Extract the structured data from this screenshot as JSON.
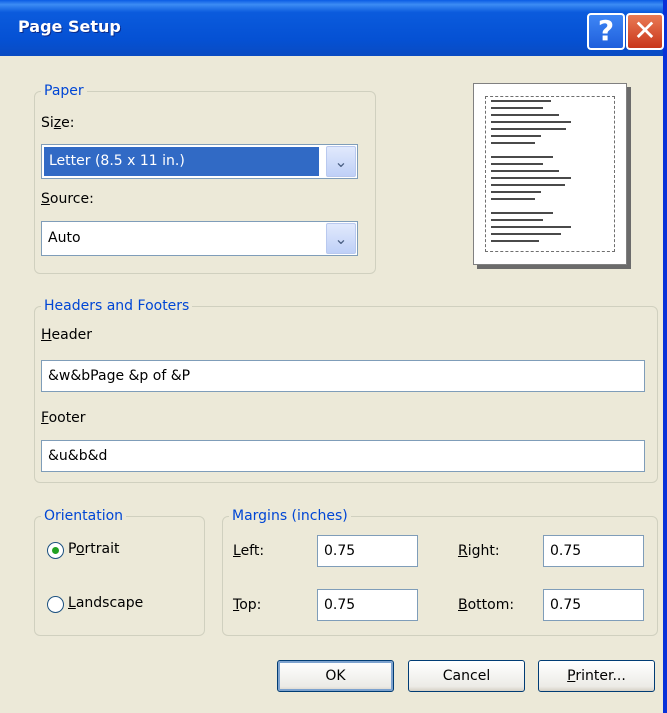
{
  "window": {
    "title": "Page Setup",
    "help_glyph": "?",
    "close_glyph": "✕"
  },
  "paper": {
    "legend": "Paper",
    "size_label_pre": "Si",
    "size_label_ul": "z",
    "size_label_post": "e:",
    "size_value": "Letter (8.5 x 11 in.)",
    "source_label_ul": "S",
    "source_label_post": "ource:",
    "source_value": "Auto"
  },
  "headers_footers": {
    "legend": "Headers and Footers",
    "header_label_ul": "H",
    "header_label_post": "eader",
    "header_value": "&w&bPage &p of &P",
    "footer_label_ul": "F",
    "footer_label_post": "ooter",
    "footer_value": "&u&b&d"
  },
  "orientation": {
    "legend": "Orientation",
    "portrait_label_pre": "P",
    "portrait_label_ul": "o",
    "portrait_label_post": "rtrait",
    "landscape_label_ul": "L",
    "landscape_label_post": "andscape",
    "selected": "portrait"
  },
  "margins": {
    "legend": "Margins (inches)",
    "left_label_ul": "L",
    "left_label_post": "eft:",
    "left_value": "0.75",
    "right_label_ul": "R",
    "right_label_post": "ight:",
    "right_value": "0.75",
    "top_label_ul": "T",
    "top_label_post": "op:",
    "top_value": "0.75",
    "bottom_label_ul": "B",
    "bottom_label_post": "ottom:",
    "bottom_value": "0.75"
  },
  "buttons": {
    "ok": "OK",
    "cancel": "Cancel",
    "printer_ul": "P",
    "printer_post": "rinter..."
  },
  "icons": {
    "dropdown": "chevron-down-icon",
    "dropdown_glyph": "⌄"
  }
}
